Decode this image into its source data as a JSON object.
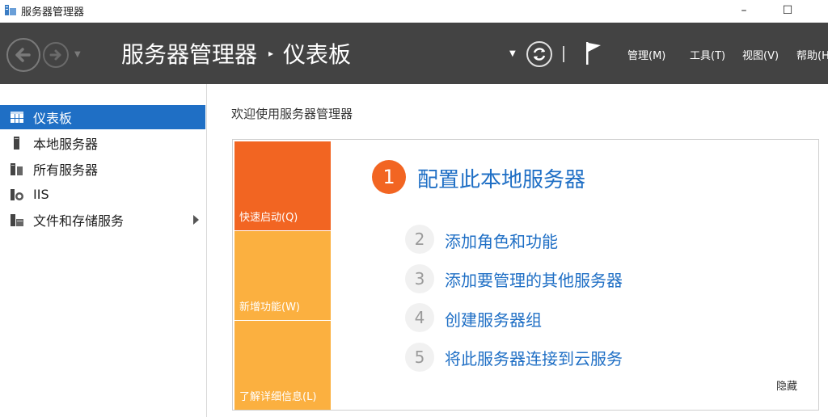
{
  "window": {
    "title": "服务器管理器",
    "minimize_glyph": "–",
    "maximize_glyph": "☐"
  },
  "header": {
    "breadcrumb_root": "服务器管理器",
    "breadcrumb_separator": "▸",
    "breadcrumb_current": "仪表板",
    "menus": [
      "管理(M)",
      "工具(T)",
      "视图(V)",
      "帮助(H"
    ]
  },
  "sidebar": {
    "items": [
      {
        "label": "仪表板",
        "icon": "dashboard-icon",
        "active": true
      },
      {
        "label": "本地服务器",
        "icon": "server-icon",
        "active": false
      },
      {
        "label": "所有服务器",
        "icon": "servers-icon",
        "active": false
      },
      {
        "label": "IIS",
        "icon": "iis-icon",
        "active": false
      },
      {
        "label": "文件和存储服务",
        "icon": "storage-icon",
        "active": false,
        "has_submenu": true
      }
    ]
  },
  "main": {
    "welcome_title": "欢迎使用服务器管理器",
    "tiles": [
      "快速启动(Q)",
      "新增功能(W)",
      "了解详细信息(L)"
    ],
    "steps": [
      {
        "number": "1",
        "label": "配置此本地服务器"
      },
      {
        "number": "2",
        "label": "添加角色和功能"
      },
      {
        "number": "3",
        "label": "添加要管理的其他服务器"
      },
      {
        "number": "4",
        "label": "创建服务器组"
      },
      {
        "number": "5",
        "label": "将此服务器连接到云服务"
      }
    ],
    "hide_label": "隐藏"
  },
  "colors": {
    "accent_blue": "#1f6fc5",
    "header_bg": "#434343",
    "orange": "#f26522",
    "amber": "#fbb040"
  }
}
